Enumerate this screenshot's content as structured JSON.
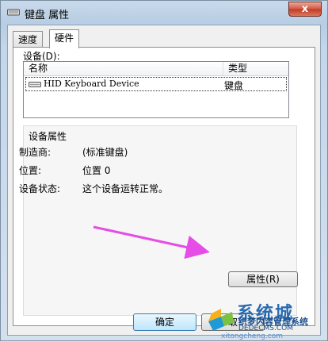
{
  "window": {
    "title": "键盘 属性",
    "close_label": "x"
  },
  "tabs": [
    {
      "label": "速度"
    },
    {
      "label": "硬件"
    }
  ],
  "devices": {
    "section_label": "设备(D):",
    "columns": [
      "名称",
      "类型"
    ],
    "rows": [
      {
        "name": "HID Keyboard Device",
        "type": "键盘"
      }
    ]
  },
  "device_properties": {
    "group_label": "设备属性",
    "manufacturer_label": "制造商:",
    "manufacturer_value": "(标准键盘)",
    "location_label": "位置:",
    "location_value": "位置 0",
    "status_label": "设备状态:",
    "status_value": "这个设备运转正常。",
    "properties_button": "属性(R)"
  },
  "footer": {
    "ok_label": "确定",
    "cancel_label": "取"
  },
  "watermark": {
    "big_text": "系统城",
    "cn_text": "织梦内容管理系统",
    "en_text": "DEDECMS.COM",
    "url_text": "xitongcheng.com"
  },
  "colors": {
    "arrow": "#e64ce6",
    "accent": "#3c7fb1"
  }
}
